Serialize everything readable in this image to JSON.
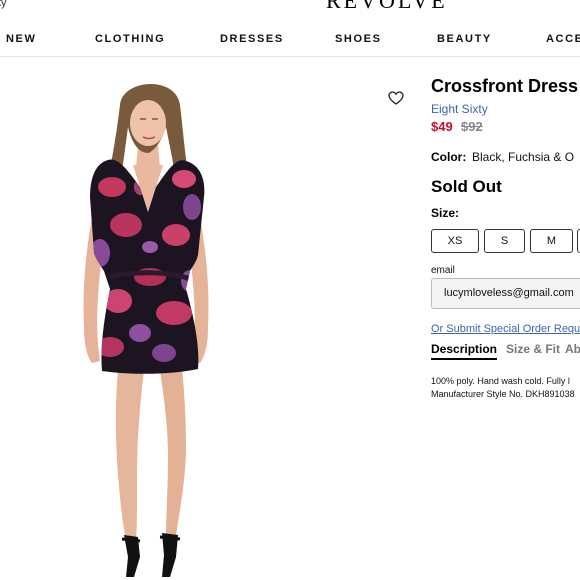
{
  "header": {
    "top_left_text": "ty",
    "logo": "REVOLVE"
  },
  "nav": {
    "items": [
      "NEW",
      "CLOTHING",
      "DRESSES",
      "SHOES",
      "BEAUTY",
      "ACCE"
    ]
  },
  "product": {
    "title": "Crossfront Dress",
    "brand": "Eight Sixty",
    "sale_price": "$49",
    "original_price": "$92",
    "color_label": "Color:",
    "color_value": "Black, Fuchsia & O",
    "status": "Sold Out",
    "size_label": "Size:",
    "sizes": [
      "XS",
      "S",
      "M",
      ""
    ],
    "email_label": "email",
    "email_value": "lucymloveless@gmail.com",
    "special_order_link": "Or Submit Special Order Requ",
    "tabs": [
      "Description",
      "Size & Fit",
      "Ab"
    ],
    "description_line1": "100% poly. Hand wash cold. Fully l",
    "description_line2": "Manufacturer Style No. DKH891038"
  },
  "icons": {
    "wishlist": "heart-icon"
  },
  "colors": {
    "link": "#3b64a8",
    "sale": "#c8102e",
    "dress_base": "#1c1420",
    "dress_pink": "#c2385e",
    "dress_purple": "#8a4a9a"
  }
}
